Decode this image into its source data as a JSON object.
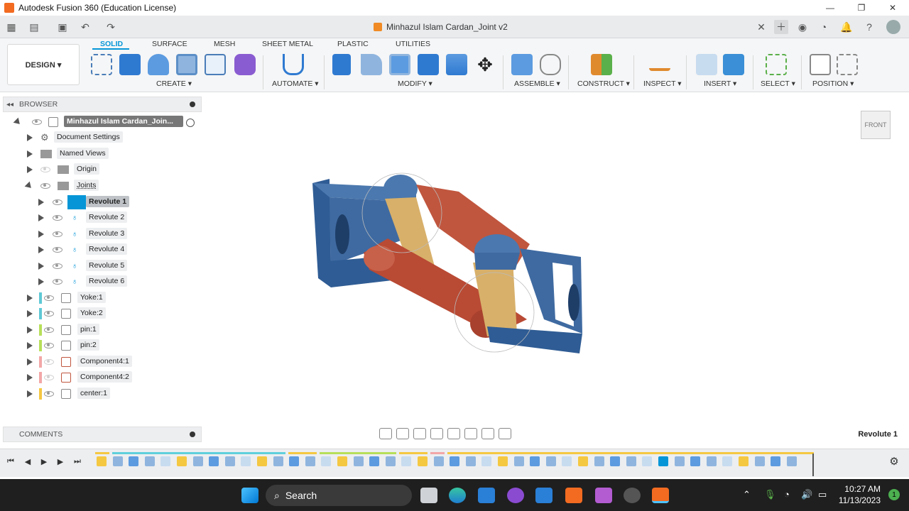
{
  "window": {
    "title": "Autodesk Fusion 360 (Education License)",
    "minimize": "—",
    "maximize": "❐",
    "close": "✕"
  },
  "tabbar": {
    "doc_title": "Minhazul Islam Cardan_Joint v2"
  },
  "ribbon": {
    "design": "DESIGN ▾",
    "tabs": [
      "SOLID",
      "SURFACE",
      "MESH",
      "SHEET METAL",
      "PLASTIC",
      "UTILITIES"
    ],
    "groups": [
      "CREATE ▾",
      "AUTOMATE ▾",
      "MODIFY ▾",
      "ASSEMBLE ▾",
      "CONSTRUCT ▾",
      "INSPECT ▾",
      "INSERT ▾",
      "SELECT ▾",
      "POSITION ▾"
    ]
  },
  "browser": {
    "header": "BROWSER",
    "root": "Minhazul Islam Cardan_Join...",
    "items": [
      "Document Settings",
      "Named Views",
      "Origin",
      "Joints",
      "Revolute 1",
      "Revolute 2",
      "Revolute 3",
      "Revolute 4",
      "Revolute 5",
      "Revolute 6",
      "Yoke:1",
      "Yoke:2",
      "pin:1",
      "pin:2",
      "Component4:1",
      "Component4:2",
      "center:1"
    ]
  },
  "viewcube": {
    "face": "FRONT"
  },
  "comments": {
    "label": "COMMENTS"
  },
  "status": {
    "selection": "Revolute 1"
  },
  "taskbar": {
    "search": "Search",
    "time": "10:27 AM",
    "date": "11/13/2023",
    "notifications": "1"
  },
  "colors": {
    "accent": "#0696d7",
    "yoke": "#3f6aa1",
    "link": "#c0563e",
    "pin": "#d8b06a"
  }
}
